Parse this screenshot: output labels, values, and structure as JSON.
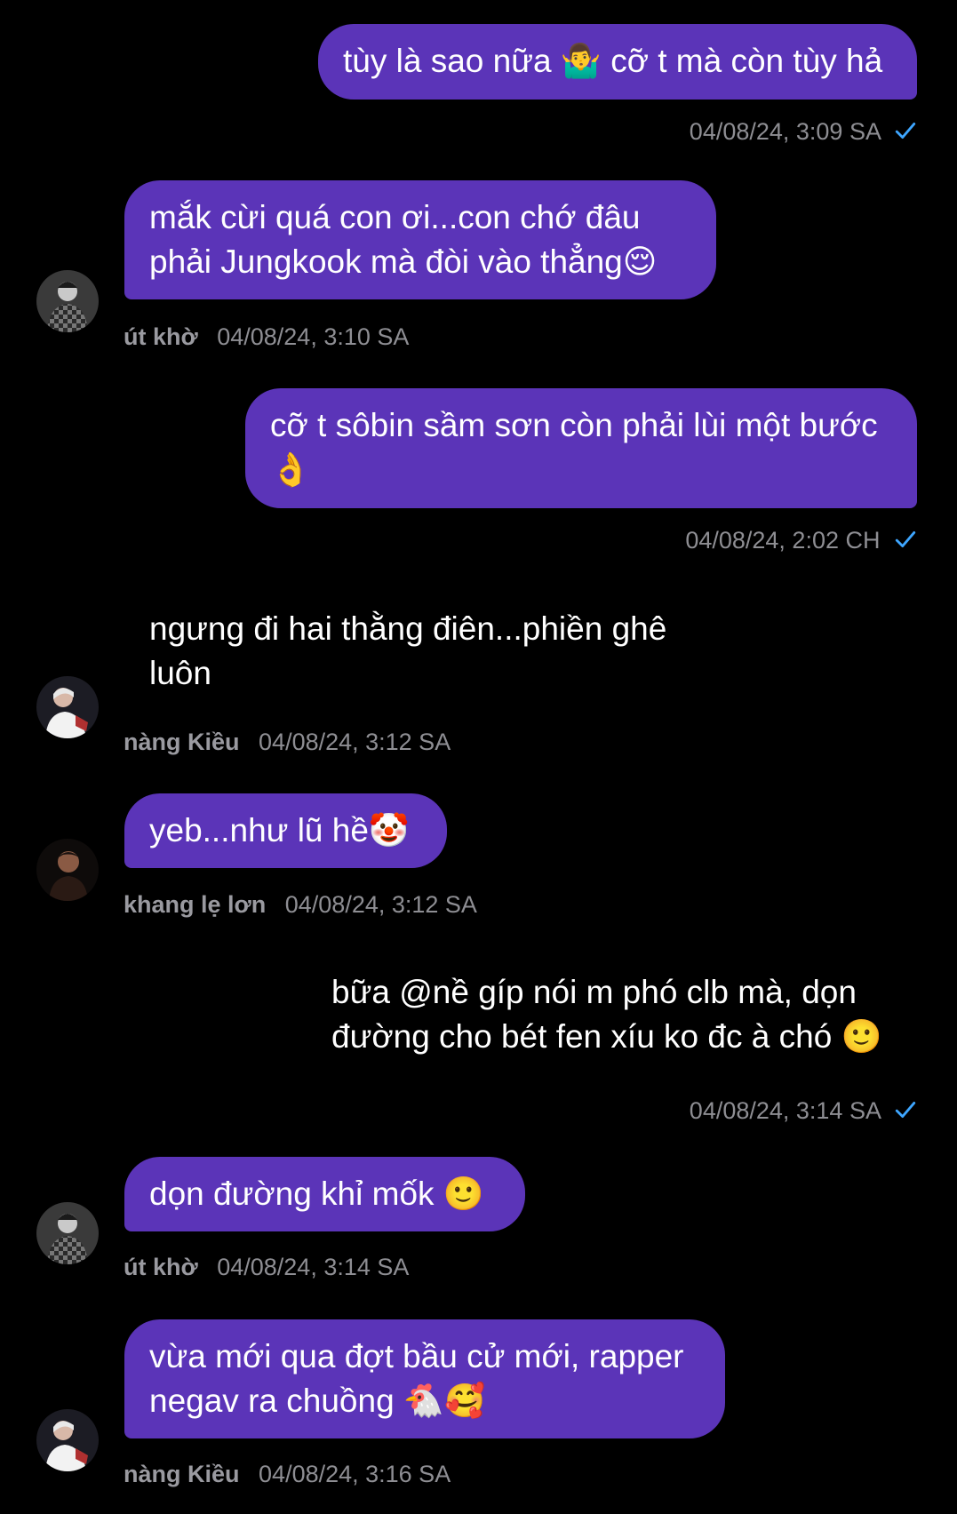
{
  "colors": {
    "background": "#000000",
    "bubble": "#5b34b8",
    "meta_text": "#8e8e93",
    "read_check": "#3ea6ff"
  },
  "messages": [
    {
      "direction": "outgoing",
      "text": "tùy là sao nữa 🤷‍♂️ cỡ t mà còn tùy hả",
      "time": "04/08/24, 3:09 SA",
      "read_icon": "check-icon"
    },
    {
      "direction": "incoming",
      "sender": "út khờ",
      "avatar_icon": "avatar-checkered-icon",
      "text": "mắk cừi quá con ơi...con chớ đâu\nphải Jungkook mà đòi vào thẳng😌",
      "time": "04/08/24, 3:10 SA"
    },
    {
      "direction": "outgoing",
      "text": "cỡ t sôbin sầm sơn còn phải lùi một bước\n👌",
      "time": "04/08/24, 2:02 CH",
      "read_icon": "check-icon"
    },
    {
      "direction": "incoming",
      "sender": "nàng Kiều",
      "avatar_icon": "avatar-person-icon",
      "text": "ngưng đi hai thằng điên...phiền ghê\nluôn",
      "time": "04/08/24, 3:12 SA"
    },
    {
      "direction": "incoming",
      "sender": "khang lẹ lơn",
      "avatar_icon": "avatar-dark-icon",
      "text": "yeb...như lũ hề🤡",
      "time": "04/08/24, 3:12 SA"
    },
    {
      "direction": "outgoing",
      "text": "bữa @nề gíp nói m phó clb mà, dọn\nđường cho bét fen xíu ko đc à chó 🙂",
      "time": "04/08/24, 3:14 SA",
      "read_icon": "check-icon"
    },
    {
      "direction": "incoming",
      "sender": "út khờ",
      "avatar_icon": "avatar-checkered-icon",
      "text": "dọn đường khỉ mốk 🙂",
      "time": "04/08/24, 3:14 SA"
    },
    {
      "direction": "incoming",
      "sender": "nàng Kiều",
      "avatar_icon": "avatar-person-icon",
      "text": "vừa mới qua đợt bầu cử mới, rapper\nnegav ra chuồng 🐔🥰",
      "time": "04/08/24, 3:16 SA"
    }
  ]
}
